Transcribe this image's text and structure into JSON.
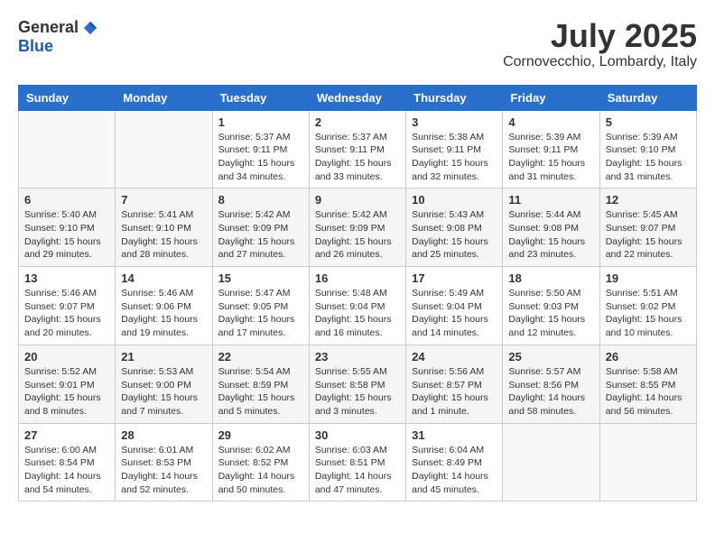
{
  "header": {
    "logo_general": "General",
    "logo_blue": "Blue",
    "month_title": "July 2025",
    "location": "Cornovecchio, Lombardy, Italy"
  },
  "weekdays": [
    "Sunday",
    "Monday",
    "Tuesday",
    "Wednesday",
    "Thursday",
    "Friday",
    "Saturday"
  ],
  "weeks": [
    [
      {
        "day": "",
        "info": ""
      },
      {
        "day": "",
        "info": ""
      },
      {
        "day": "1",
        "info": "Sunrise: 5:37 AM\nSunset: 9:11 PM\nDaylight: 15 hours\nand 34 minutes."
      },
      {
        "day": "2",
        "info": "Sunrise: 5:37 AM\nSunset: 9:11 PM\nDaylight: 15 hours\nand 33 minutes."
      },
      {
        "day": "3",
        "info": "Sunrise: 5:38 AM\nSunset: 9:11 PM\nDaylight: 15 hours\nand 32 minutes."
      },
      {
        "day": "4",
        "info": "Sunrise: 5:39 AM\nSunset: 9:11 PM\nDaylight: 15 hours\nand 31 minutes."
      },
      {
        "day": "5",
        "info": "Sunrise: 5:39 AM\nSunset: 9:10 PM\nDaylight: 15 hours\nand 31 minutes."
      }
    ],
    [
      {
        "day": "6",
        "info": "Sunrise: 5:40 AM\nSunset: 9:10 PM\nDaylight: 15 hours\nand 29 minutes."
      },
      {
        "day": "7",
        "info": "Sunrise: 5:41 AM\nSunset: 9:10 PM\nDaylight: 15 hours\nand 28 minutes."
      },
      {
        "day": "8",
        "info": "Sunrise: 5:42 AM\nSunset: 9:09 PM\nDaylight: 15 hours\nand 27 minutes."
      },
      {
        "day": "9",
        "info": "Sunrise: 5:42 AM\nSunset: 9:09 PM\nDaylight: 15 hours\nand 26 minutes."
      },
      {
        "day": "10",
        "info": "Sunrise: 5:43 AM\nSunset: 9:08 PM\nDaylight: 15 hours\nand 25 minutes."
      },
      {
        "day": "11",
        "info": "Sunrise: 5:44 AM\nSunset: 9:08 PM\nDaylight: 15 hours\nand 23 minutes."
      },
      {
        "day": "12",
        "info": "Sunrise: 5:45 AM\nSunset: 9:07 PM\nDaylight: 15 hours\nand 22 minutes."
      }
    ],
    [
      {
        "day": "13",
        "info": "Sunrise: 5:46 AM\nSunset: 9:07 PM\nDaylight: 15 hours\nand 20 minutes."
      },
      {
        "day": "14",
        "info": "Sunrise: 5:46 AM\nSunset: 9:06 PM\nDaylight: 15 hours\nand 19 minutes."
      },
      {
        "day": "15",
        "info": "Sunrise: 5:47 AM\nSunset: 9:05 PM\nDaylight: 15 hours\nand 17 minutes."
      },
      {
        "day": "16",
        "info": "Sunrise: 5:48 AM\nSunset: 9:04 PM\nDaylight: 15 hours\nand 16 minutes."
      },
      {
        "day": "17",
        "info": "Sunrise: 5:49 AM\nSunset: 9:04 PM\nDaylight: 15 hours\nand 14 minutes."
      },
      {
        "day": "18",
        "info": "Sunrise: 5:50 AM\nSunset: 9:03 PM\nDaylight: 15 hours\nand 12 minutes."
      },
      {
        "day": "19",
        "info": "Sunrise: 5:51 AM\nSunset: 9:02 PM\nDaylight: 15 hours\nand 10 minutes."
      }
    ],
    [
      {
        "day": "20",
        "info": "Sunrise: 5:52 AM\nSunset: 9:01 PM\nDaylight: 15 hours\nand 8 minutes."
      },
      {
        "day": "21",
        "info": "Sunrise: 5:53 AM\nSunset: 9:00 PM\nDaylight: 15 hours\nand 7 minutes."
      },
      {
        "day": "22",
        "info": "Sunrise: 5:54 AM\nSunset: 8:59 PM\nDaylight: 15 hours\nand 5 minutes."
      },
      {
        "day": "23",
        "info": "Sunrise: 5:55 AM\nSunset: 8:58 PM\nDaylight: 15 hours\nand 3 minutes."
      },
      {
        "day": "24",
        "info": "Sunrise: 5:56 AM\nSunset: 8:57 PM\nDaylight: 15 hours\nand 1 minute."
      },
      {
        "day": "25",
        "info": "Sunrise: 5:57 AM\nSunset: 8:56 PM\nDaylight: 14 hours\nand 58 minutes."
      },
      {
        "day": "26",
        "info": "Sunrise: 5:58 AM\nSunset: 8:55 PM\nDaylight: 14 hours\nand 56 minutes."
      }
    ],
    [
      {
        "day": "27",
        "info": "Sunrise: 6:00 AM\nSunset: 8:54 PM\nDaylight: 14 hours\nand 54 minutes."
      },
      {
        "day": "28",
        "info": "Sunrise: 6:01 AM\nSunset: 8:53 PM\nDaylight: 14 hours\nand 52 minutes."
      },
      {
        "day": "29",
        "info": "Sunrise: 6:02 AM\nSunset: 8:52 PM\nDaylight: 14 hours\nand 50 minutes."
      },
      {
        "day": "30",
        "info": "Sunrise: 6:03 AM\nSunset: 8:51 PM\nDaylight: 14 hours\nand 47 minutes."
      },
      {
        "day": "31",
        "info": "Sunrise: 6:04 AM\nSunset: 8:49 PM\nDaylight: 14 hours\nand 45 minutes."
      },
      {
        "day": "",
        "info": ""
      },
      {
        "day": "",
        "info": ""
      }
    ]
  ]
}
